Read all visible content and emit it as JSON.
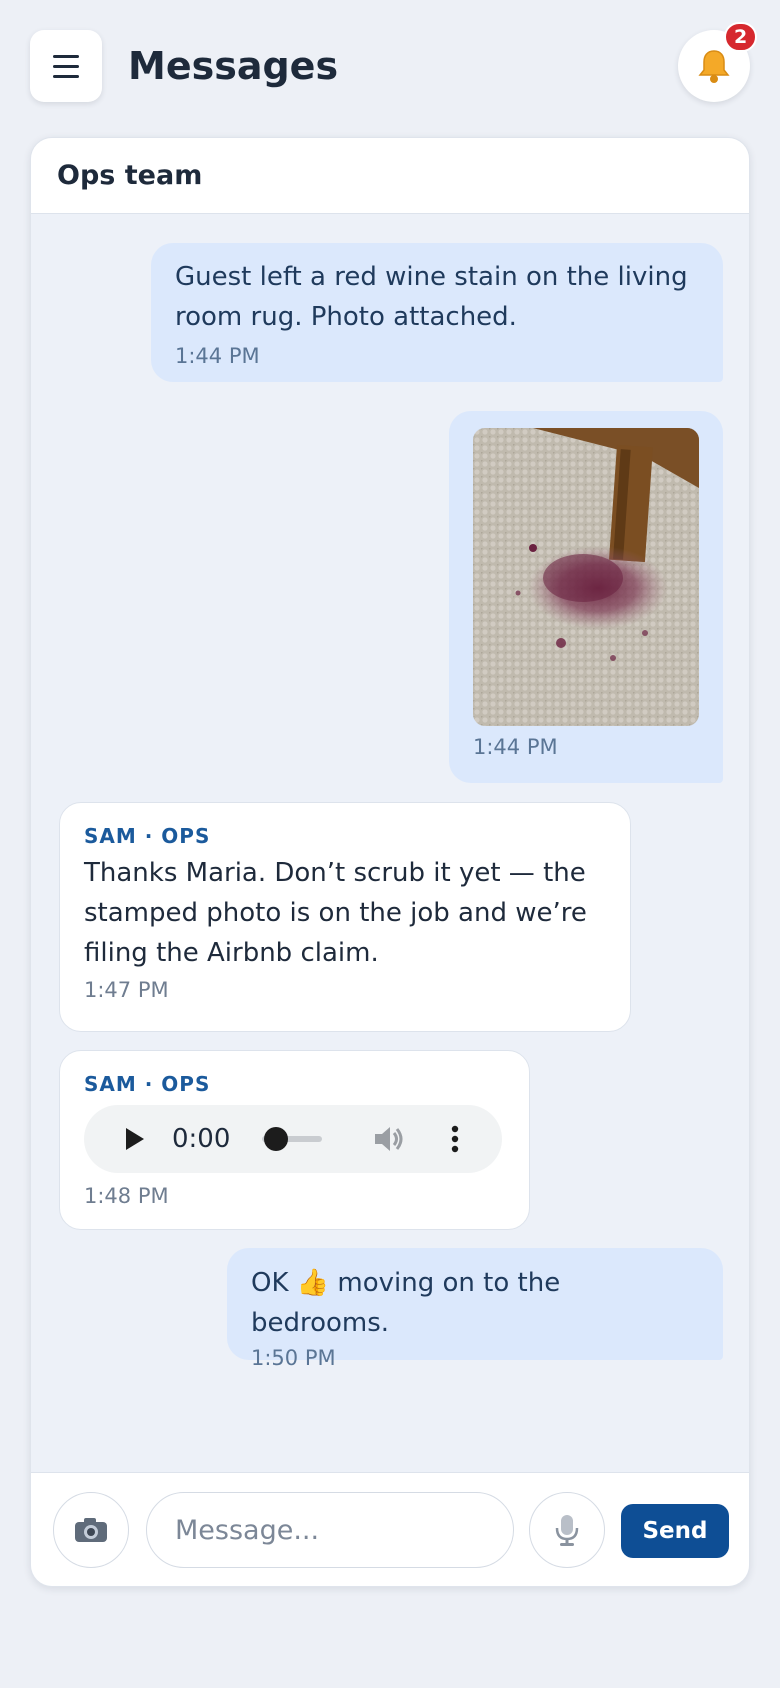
{
  "header": {
    "title": "Messages",
    "notification_count": "2"
  },
  "chat": {
    "title": "Ops team",
    "messages": [
      {
        "direction": "out",
        "text": "Guest left a red wine stain on the living room rug. Photo attached.",
        "time": "1:44 PM"
      },
      {
        "direction": "out",
        "type": "image",
        "time": "1:44 PM"
      },
      {
        "direction": "in",
        "sender": "SAM · OPS",
        "text": "Thanks Maria. Don’t scrub it yet — the stamped photo is on the job and we’re filing the Airbnb claim.",
        "time": "1:47 PM"
      },
      {
        "direction": "in",
        "sender": "SAM · OPS",
        "type": "audio",
        "audio_time": "0:00",
        "time": "1:48 PM"
      },
      {
        "direction": "out",
        "text": "OK 👍 moving on to the bedrooms.",
        "time": "1:50 PM"
      }
    ]
  },
  "composer": {
    "placeholder": "Message...",
    "send_label": "Send"
  },
  "colors": {
    "accent": "#0e4e95",
    "outgoing_bubble": "#dbe8fc",
    "badge": "#d6282e",
    "sender": "#1b5a9c"
  },
  "icons": {
    "menu": "hamburger-icon",
    "bell": "bell-icon",
    "camera": "camera-icon",
    "mic": "microphone-icon"
  }
}
